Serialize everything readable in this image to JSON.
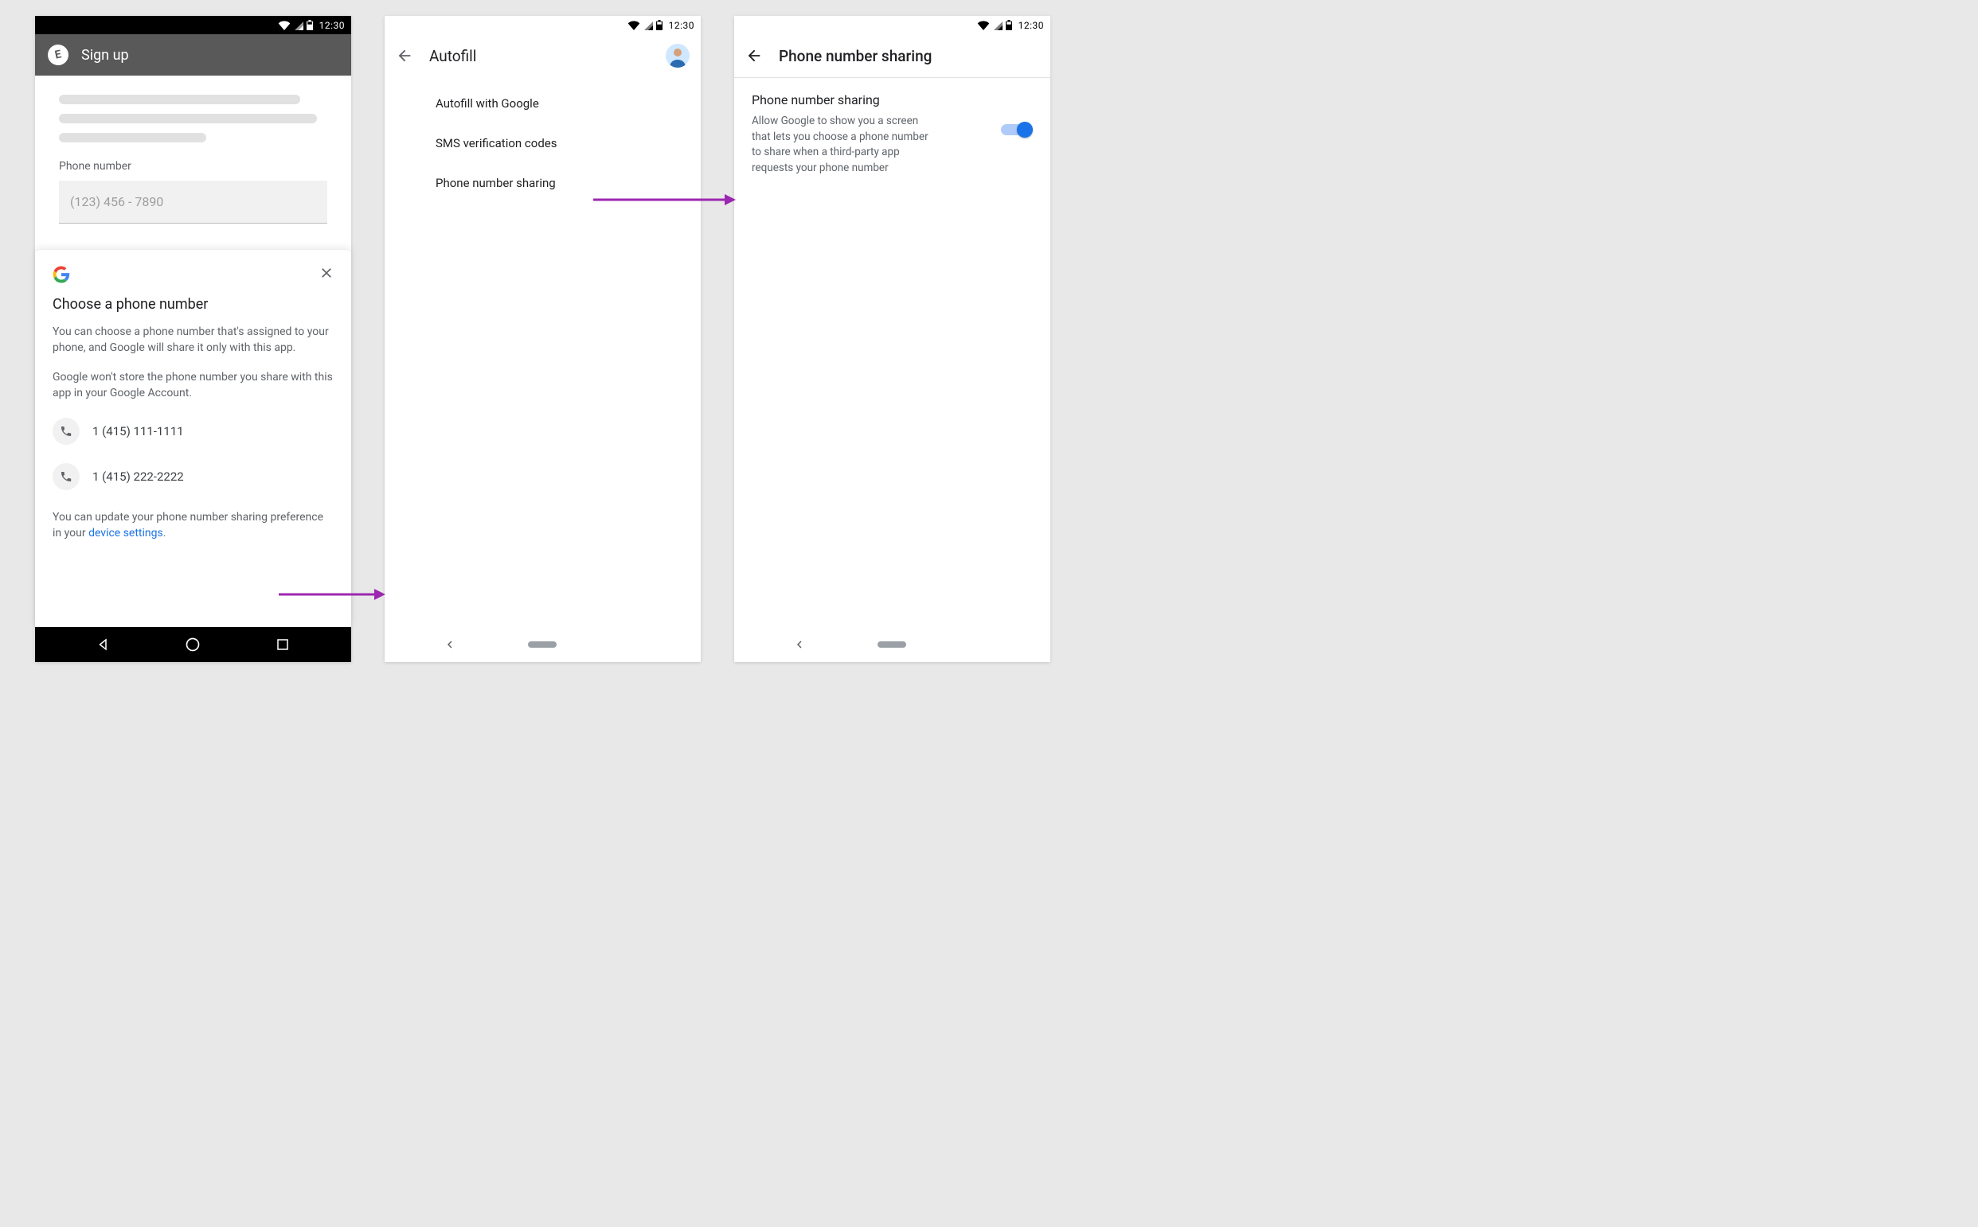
{
  "status": {
    "time": "12:30"
  },
  "screen1": {
    "app_title": "Sign up",
    "field_label": "Phone number",
    "field_placeholder": "(123) 456 - 7890",
    "sheet": {
      "title": "Choose a phone number",
      "para1": "You can choose a phone number that's assigned to your phone, and Google will share it only with this app.",
      "para2": "Google won't store the phone number you share with this app in your Google Account.",
      "options": [
        {
          "number": "1 (415) 111-1111"
        },
        {
          "number": "1 (415) 222-2222"
        }
      ],
      "footnote_pre": "You can update your phone number sharing preference in your ",
      "footnote_link": "device settings",
      "footnote_post": "."
    }
  },
  "screen2": {
    "title": "Autofill",
    "items": [
      {
        "label": "Autofill with Google"
      },
      {
        "label": "SMS verification codes"
      },
      {
        "label": "Phone number sharing"
      }
    ]
  },
  "screen3": {
    "title": "Phone number sharing",
    "setting_title": "Phone number sharing",
    "setting_desc": "Allow Google to show you a screen that lets you choose a phone number to share when a third-party app requests your phone number",
    "toggle_on": true
  }
}
